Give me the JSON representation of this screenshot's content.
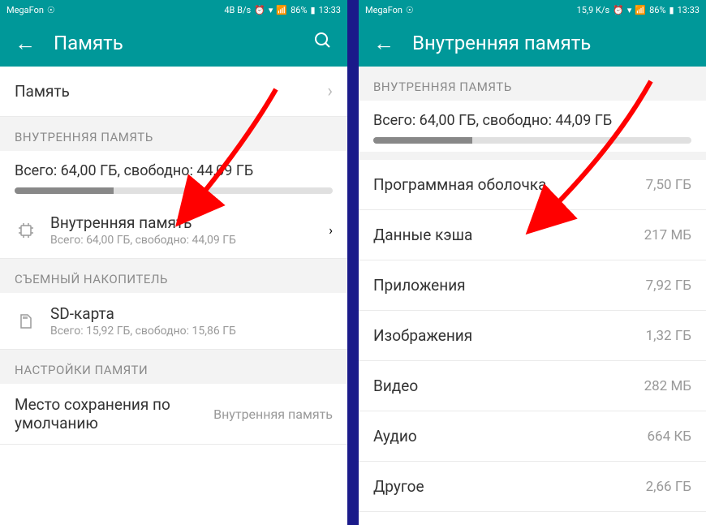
{
  "left": {
    "status": {
      "carrier": "MegaFon",
      "speed": "4В B/s",
      "battery": "86%",
      "time": "13:33"
    },
    "header": {
      "title": "Память"
    },
    "row_memory": "Память",
    "section_internal": "ВНУТРЕННЯЯ ПАМЯТЬ",
    "summary": "Всего: 64,00 ГБ, свободно: 44,09 ГБ",
    "internal": {
      "title": "Внутренняя память",
      "sub": "Всего: 64,00 ГБ, свободно: 44,09 ГБ"
    },
    "section_removable": "СЪЕМНЫЙ НАКОПИТЕЛЬ",
    "sd": {
      "title": "SD-карта",
      "sub": "Всего: 15,92 ГБ, свободно: 15,86 ГБ"
    },
    "section_settings": "НАСТРОЙКИ ПАМЯТИ",
    "default_location": {
      "title": "Место сохранения по умолчанию",
      "value": "Внутренняя память"
    }
  },
  "right": {
    "status": {
      "carrier": "MegaFon",
      "speed": "15,9 K/s",
      "battery": "86%",
      "time": "13:33"
    },
    "header": {
      "title": "Внутренняя память"
    },
    "section_internal": "ВНУТРЕННЯЯ ПАМЯТЬ",
    "summary": "Всего: 64,00 ГБ, свободно: 44,09 ГБ",
    "rows": [
      {
        "label": "Программная оболочка",
        "value": "7,50 ГБ"
      },
      {
        "label": "Данные кэша",
        "value": "217 МБ"
      },
      {
        "label": "Приложения",
        "value": "7,92 ГБ"
      },
      {
        "label": "Изображения",
        "value": "1,32 ГБ"
      },
      {
        "label": "Видео",
        "value": "282 МБ"
      },
      {
        "label": "Аудио",
        "value": "664 КБ"
      },
      {
        "label": "Другое",
        "value": "2,66 ГБ"
      }
    ]
  }
}
